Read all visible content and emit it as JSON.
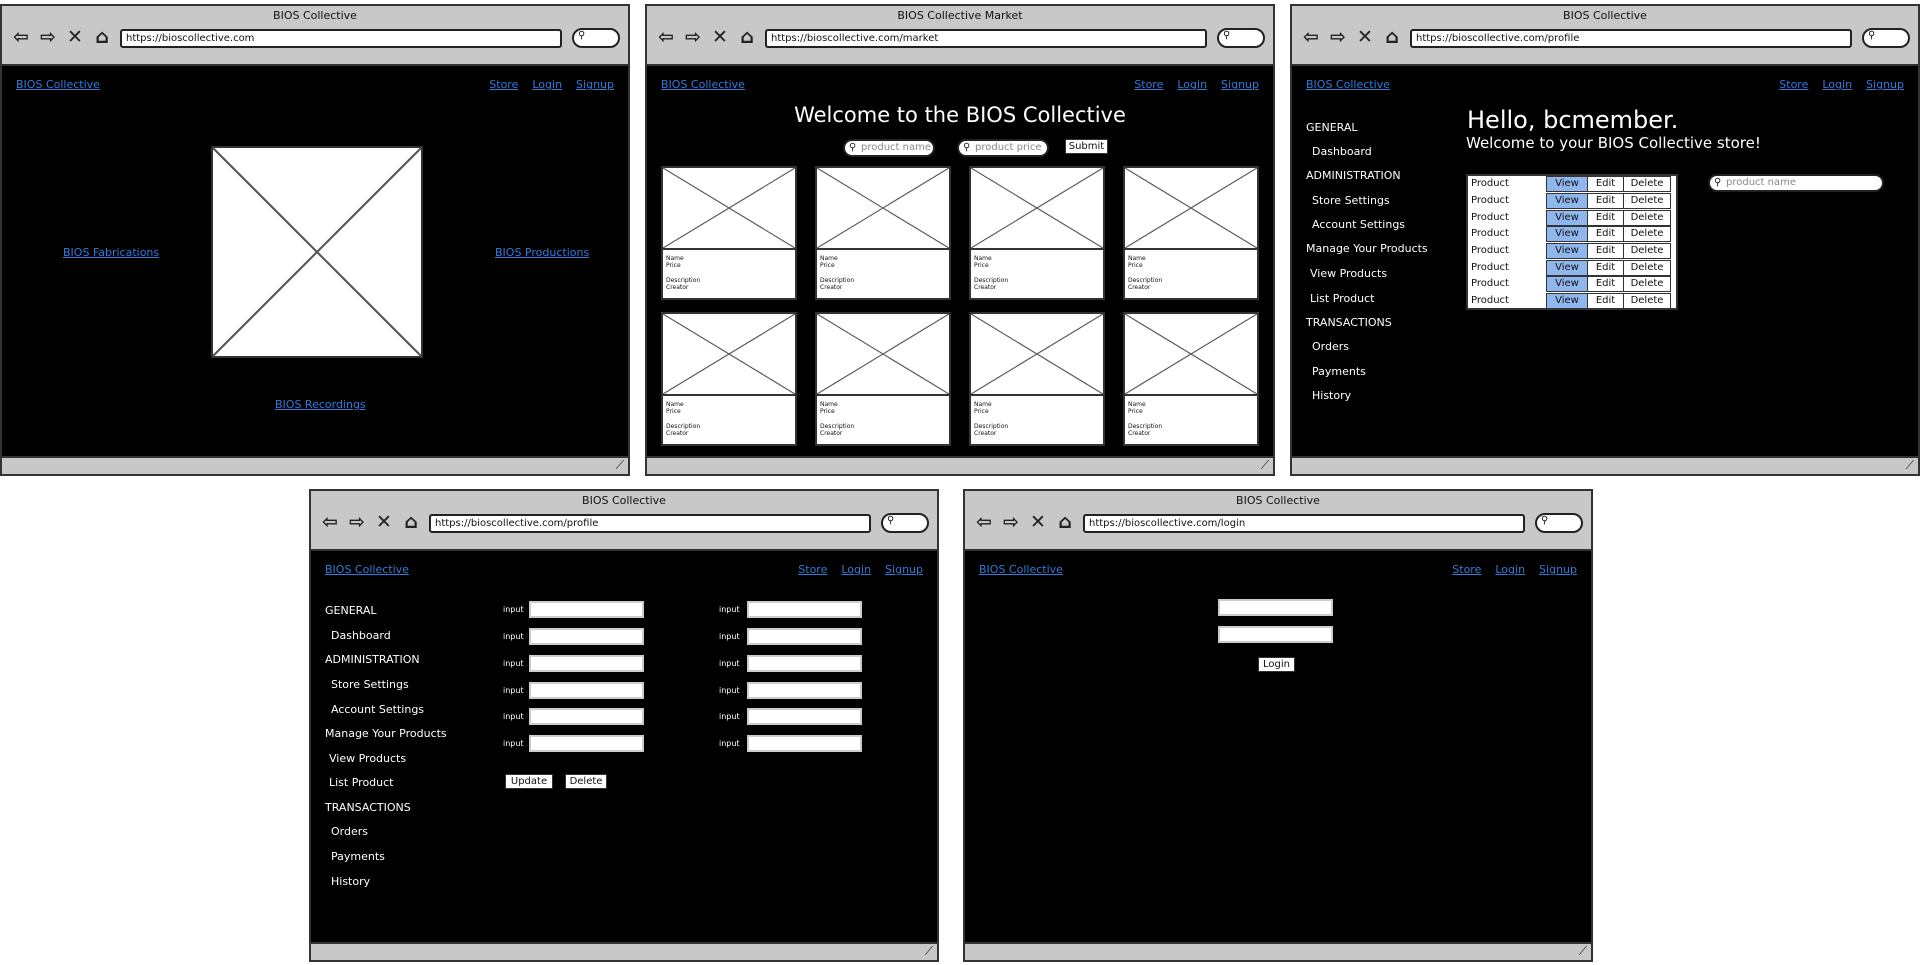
{
  "common": {
    "brand": "BIOS Collective",
    "nav": [
      "Store",
      "Login",
      "Signup"
    ]
  },
  "win1": {
    "title": "BIOS Collective",
    "url": "https://bioscollective.com",
    "link_left": "BIOS Fabrications",
    "link_right": "BIOS Productions",
    "link_bottom": "BIOS Recordings"
  },
  "win2": {
    "title": "BIOS Collective Market",
    "url": "https://bioscollective.com/market",
    "welcome": "Welcome to the BIOS Collective",
    "search_name_placeholder": "product name",
    "search_price_placeholder": "product price",
    "submit": "Submit",
    "card": {
      "name": "Name",
      "price": "Price",
      "description": "Description",
      "creator": "Creator"
    }
  },
  "win3": {
    "title": "BIOS Collective",
    "url": "https://bioscollective.com/profile",
    "hello": "Hello, bcmember.",
    "welcome": "Welcome to your BIOS Collective store!",
    "search_placeholder": "product name",
    "product_label": "Product",
    "view": "View",
    "edit": "Edit",
    "delete": "Delete",
    "row_count": 8
  },
  "sidebar": {
    "general": "GENERAL",
    "dashboard": "Dashboard",
    "administration": "ADMINISTRATION",
    "store_settings": "Store Settings",
    "account_settings": "Account Settings",
    "manage": "Manage Your Products",
    "view_products": "View Products",
    "list_product": "List Product",
    "transactions": "TRANSACTIONS",
    "orders": "Orders",
    "payments": "Payments",
    "history": "History"
  },
  "win4": {
    "title": "BIOS Collective",
    "url": "https://bioscollective.com/profile",
    "input_label": "input",
    "update": "Update",
    "delete": "Delete"
  },
  "win5": {
    "title": "BIOS Collective",
    "url": "https://bioscollective.com/login",
    "login": "Login"
  }
}
